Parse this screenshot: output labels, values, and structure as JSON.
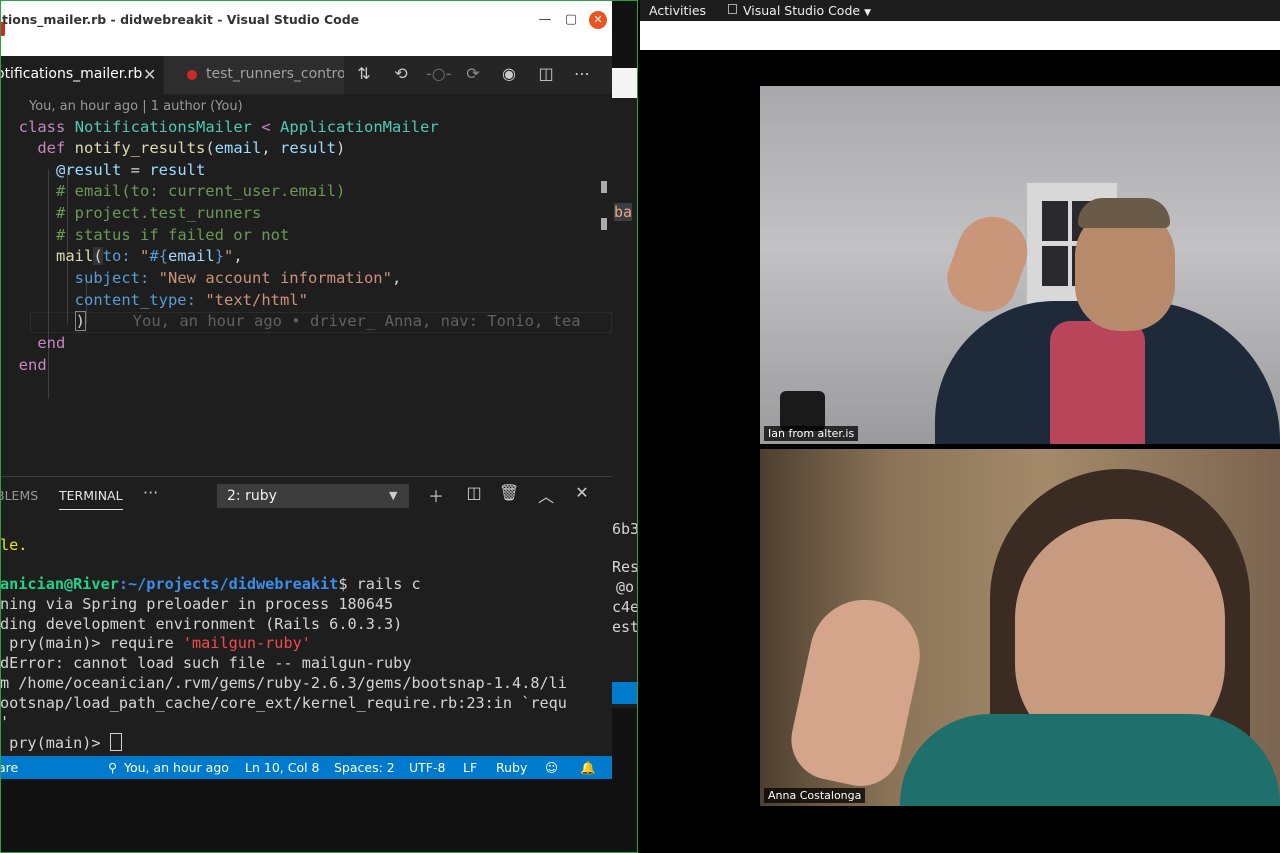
{
  "window": {
    "title": "tions_mailer.rb - didwebreakit - Visual Studio Code"
  },
  "tabs": [
    {
      "label": "otifications_mailer.rb",
      "close": "✕"
    },
    {
      "label": "test_runners_contro"
    }
  ],
  "editor": {
    "codelens": "You, an hour ago | 1 author (You)",
    "blame": "You, an hour ago • driver_ Anna, nav: Tonio, tea"
  },
  "panel": {
    "problems_tab": "BLEMS",
    "terminal_tab": "TERMINAL",
    "more": "···",
    "selected_terminal": "2: ruby"
  },
  "terminal": {
    "line1": "le.",
    "prompt_user": "anician@River",
    "prompt_path": ":~/projects/didwebreakit",
    "prompt_cmd": "$ rails c",
    "line_spring": "ning via Spring preloader in process 180645",
    "line_env": "ding development environment (Rails 6.0.3.3)",
    "pry_prefix": " pry(main)> require ",
    "pry_arg": "'mailgun-ruby'",
    "line_error": "dError: cannot load such file -- mailgun-ruby",
    "line_from": "m /home/oceanician/.rvm/gems/ruby-2.6.3/gems/bootsnap-1.4.8/li",
    "line_path": "ootsnap/load_path_cache/core_ext/kernel_require.rb:23:in `requ",
    "line_quote": "'",
    "pry_prompt": " pry(main)> "
  },
  "statusbar": {
    "left": "are",
    "blame": "You, an hour ago",
    "position": "Ln 10, Col 8",
    "spaces": "Spaces: 2",
    "encoding": "UTF-8",
    "eol": "LF",
    "language": "Ruby"
  },
  "background_window": {
    "fragments": [
      "ba",
      "6b3",
      "Res",
      "@o",
      "c4e",
      "est"
    ]
  },
  "topbar": {
    "activities": "Activities",
    "app_menu": "Visual Studio Code"
  },
  "participants": [
    {
      "name": "Ian from alter.is"
    },
    {
      "name": "Anna Costalonga"
    }
  ],
  "colors": {
    "status_blue": "#007acc",
    "share_border": "#2ea043",
    "ubuntu_orange": "#e95420"
  }
}
